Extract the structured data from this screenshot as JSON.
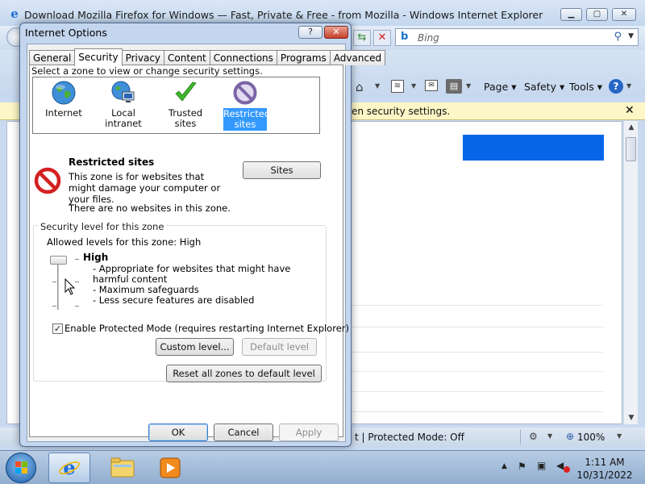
{
  "browser": {
    "title": "Download Mozilla Firefox for Windows — Fast, Private & Free - from Mozilla - Windows Internet Explorer",
    "search_placeholder": "Bing",
    "command_bar": {
      "page": "Page ▾",
      "safety": "Safety ▾",
      "tools": "Tools ▾"
    },
    "infobar_text": "en security settings.",
    "statusbar": {
      "protected_mode": "t | Protected Mode: Off",
      "zoom": "100%"
    },
    "accent_color": "#0865e8"
  },
  "dialog": {
    "title": "Internet Options",
    "tabs": [
      "General",
      "Security",
      "Privacy",
      "Content",
      "Connections",
      "Programs",
      "Advanced"
    ],
    "active_tab": "Security",
    "zone_prompt": "Select a zone to view or change security settings.",
    "zones": [
      {
        "label": "Internet",
        "icon": "globe-icon"
      },
      {
        "label": "Local intranet",
        "icon": "intranet-icon"
      },
      {
        "label": "Trusted sites",
        "icon": "checkmark-icon"
      },
      {
        "label": "Restricted sites",
        "icon": "restricted-icon"
      }
    ],
    "selected_zone": {
      "name": "Restricted sites",
      "description": "This zone is for websites that might damage your computer or your files.",
      "no_sites": "There are no websites in this zone.",
      "sites_button": "Sites"
    },
    "security_level": {
      "group_title": "Security level for this zone",
      "allowed": "Allowed levels for this zone: High",
      "level_name": "High",
      "details": [
        "- Appropriate for websites that might have harmful content",
        "- Maximum safeguards",
        "- Less secure features are disabled"
      ],
      "slider_level": "High",
      "protected_mode_label": "Enable Protected Mode (requires restarting Internet Explorer)",
      "protected_mode_checked": true,
      "custom_button": "Custom level...",
      "default_button": "Default level"
    },
    "reset_button": "Reset all zones to default level",
    "buttons": {
      "ok": "OK",
      "cancel": "Cancel",
      "apply": "Apply"
    }
  },
  "taskbar": {
    "time": "1:11 AM",
    "date": "10/31/2022"
  }
}
